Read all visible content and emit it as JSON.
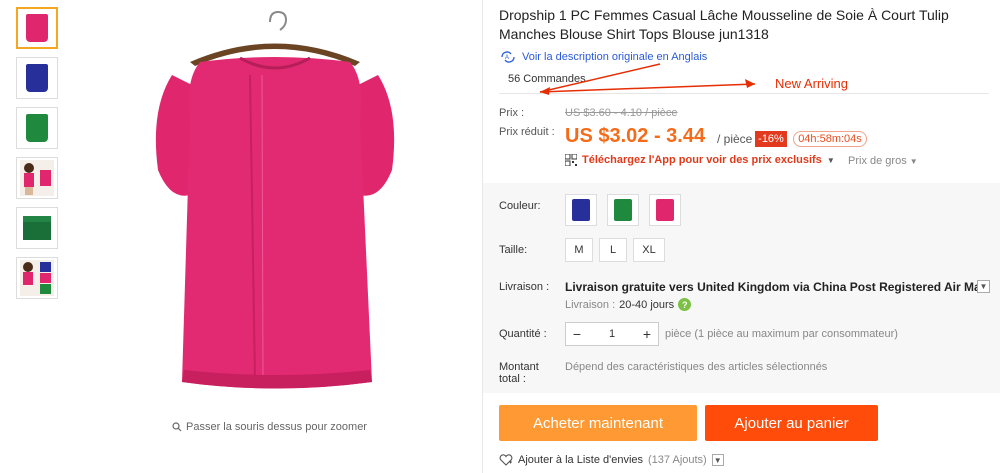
{
  "product": {
    "title": "Dropship 1 PC Femmes Casual Lâche Mousseline de Soie À Court Tulip Manches Blouse Shirt Tops Blouse jun1318",
    "original_link": "Voir la description originale en Anglais",
    "orders": "56 Commandes",
    "annotation": "New Arriving"
  },
  "gallery": {
    "zoom_hint": "Passer la souris dessus pour zoomer",
    "thumbnails": [
      "pink",
      "blue",
      "green",
      "model-pink",
      "green-folded",
      "model-multi"
    ]
  },
  "pricing": {
    "price_label": "Prix :",
    "old_price": "US $3.60 - 4.10 / pièce",
    "reduced_label": "Prix réduit :",
    "price": "US $3.02 - 3.44",
    "per_unit": "/ pièce",
    "discount": "-16%",
    "timer": "04h:58m:04s",
    "app_promo": "Téléchargez l'App pour voir des prix exclusifs",
    "wholesale": "Prix de gros"
  },
  "options": {
    "color_label": "Couleur:",
    "size_label": "Taille:",
    "sizes": [
      "M",
      "L",
      "XL"
    ],
    "shipping_label": "Livraison :",
    "shipping_bold": "Livraison gratuite vers",
    "shipping_rest": "United Kingdom via China Post Registered Air Mail",
    "delivery_label": "Livraison :",
    "delivery_days": "20-40 jours",
    "quantity_label": "Quantité :",
    "quantity_value": "1",
    "quantity_note": "pièce (1 pièce au maximum par consommateur)",
    "total_label_1": "Montant",
    "total_label_2": "total :",
    "total_note": "Dépend des caractéristiques des articles sélectionnés"
  },
  "actions": {
    "buy_now": "Acheter maintenant",
    "add_to_cart": "Ajouter au panier",
    "wishlist": "Ajouter à la Liste d'envies",
    "wishlist_count": "(137 Ajouts)"
  },
  "colors": {
    "pink": "#e0276e",
    "blue": "#27309a",
    "green": "#1f8a3e",
    "accent_orange": "#ff9933",
    "cart_red": "#ff4c0a",
    "price_orange": "#f46c1a"
  }
}
